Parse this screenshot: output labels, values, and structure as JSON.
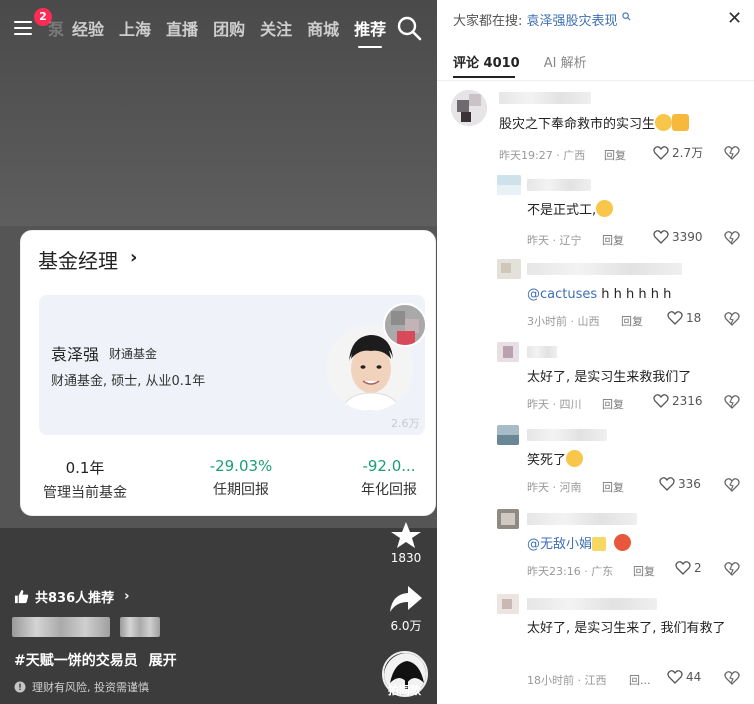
{
  "nav": {
    "badge_count": "2",
    "tabs": [
      {
        "label": "泵",
        "state": "faded"
      },
      {
        "label": "经验",
        "state": "normal"
      },
      {
        "label": "上海",
        "state": "normal"
      },
      {
        "label": "直播",
        "state": "normal"
      },
      {
        "label": "团购",
        "state": "normal"
      },
      {
        "label": "关注",
        "state": "normal"
      },
      {
        "label": "商城",
        "state": "normal"
      },
      {
        "label": "推荐",
        "state": "active"
      }
    ]
  },
  "fund_card": {
    "title": "基金经理",
    "chevron": "›",
    "manager_name": "袁泽强",
    "manager_company": "财通基金",
    "manager_desc": "财通基金, 硕士, 从业0.1年",
    "stats": [
      {
        "value": "0.1年",
        "label": "管理当前基金",
        "tone": "neutral"
      },
      {
        "value": "-29.03%",
        "label": "任期回报",
        "tone": "down"
      },
      {
        "value": "-92.0...",
        "label": "年化回报",
        "tone": "down"
      }
    ]
  },
  "video": {
    "faint_like_count": "2.6万",
    "favorite_count": "1830",
    "share_count": "6.0万",
    "recommend_text": "共836人推荐",
    "recommend_chevron": "›",
    "topic_text": "#天赋一饼的交易员",
    "expand_label": "展开",
    "risk_text": "理财有风险, 投资需谨慎",
    "music_label": "拍同款"
  },
  "comments_panel": {
    "search_prefix": "大家都在搜:",
    "search_query": "袁泽强股灾表现",
    "tabs": [
      {
        "label": "评论 4010",
        "active": true
      },
      {
        "label": "AI 解析",
        "active": false
      }
    ],
    "reply_label": "回复",
    "comments": [
      {
        "text": "股灾之下奉命救市的实习生",
        "emojis": [
          "laugh-cry",
          "thumbs-up"
        ],
        "time": "昨天19:27 · 广西",
        "reply": "回复",
        "likes": "2.7万"
      },
      {
        "text": "不是正式工,",
        "emojis": [
          "laugh-cry"
        ],
        "time": "昨天 · 辽宁",
        "reply": "回复",
        "likes": "3390"
      },
      {
        "mention": "@cactuses",
        "text": " h h h h h h",
        "emojis": [],
        "time": "3小时前 · 山西",
        "reply": "回复",
        "likes": "18"
      },
      {
        "text": "太好了, 是实习生来救我们了",
        "emojis": [],
        "time": "昨天 · 四川",
        "reply": "回复",
        "likes": "2316"
      },
      {
        "text": "笑死了",
        "emojis": [
          "laugh-cry"
        ],
        "time": "昨天 · 河南",
        "reply": "回复",
        "likes": "336"
      },
      {
        "mention": "@无敌小娟",
        "text": "",
        "emojis": [
          "sparkles",
          "angry-face"
        ],
        "time": "昨天23:16 · 广东",
        "reply": "回复",
        "likes": "2"
      },
      {
        "text": "太好了, 是实习生来了, 我们有救了",
        "emojis": [],
        "time": "18小时前 · 江西",
        "reply": "回...",
        "likes": "44"
      }
    ]
  },
  "colors": {
    "accent_red": "#fe2c55",
    "link_blue": "#3d6fb5",
    "fund_down_green": "#1a9e75"
  }
}
